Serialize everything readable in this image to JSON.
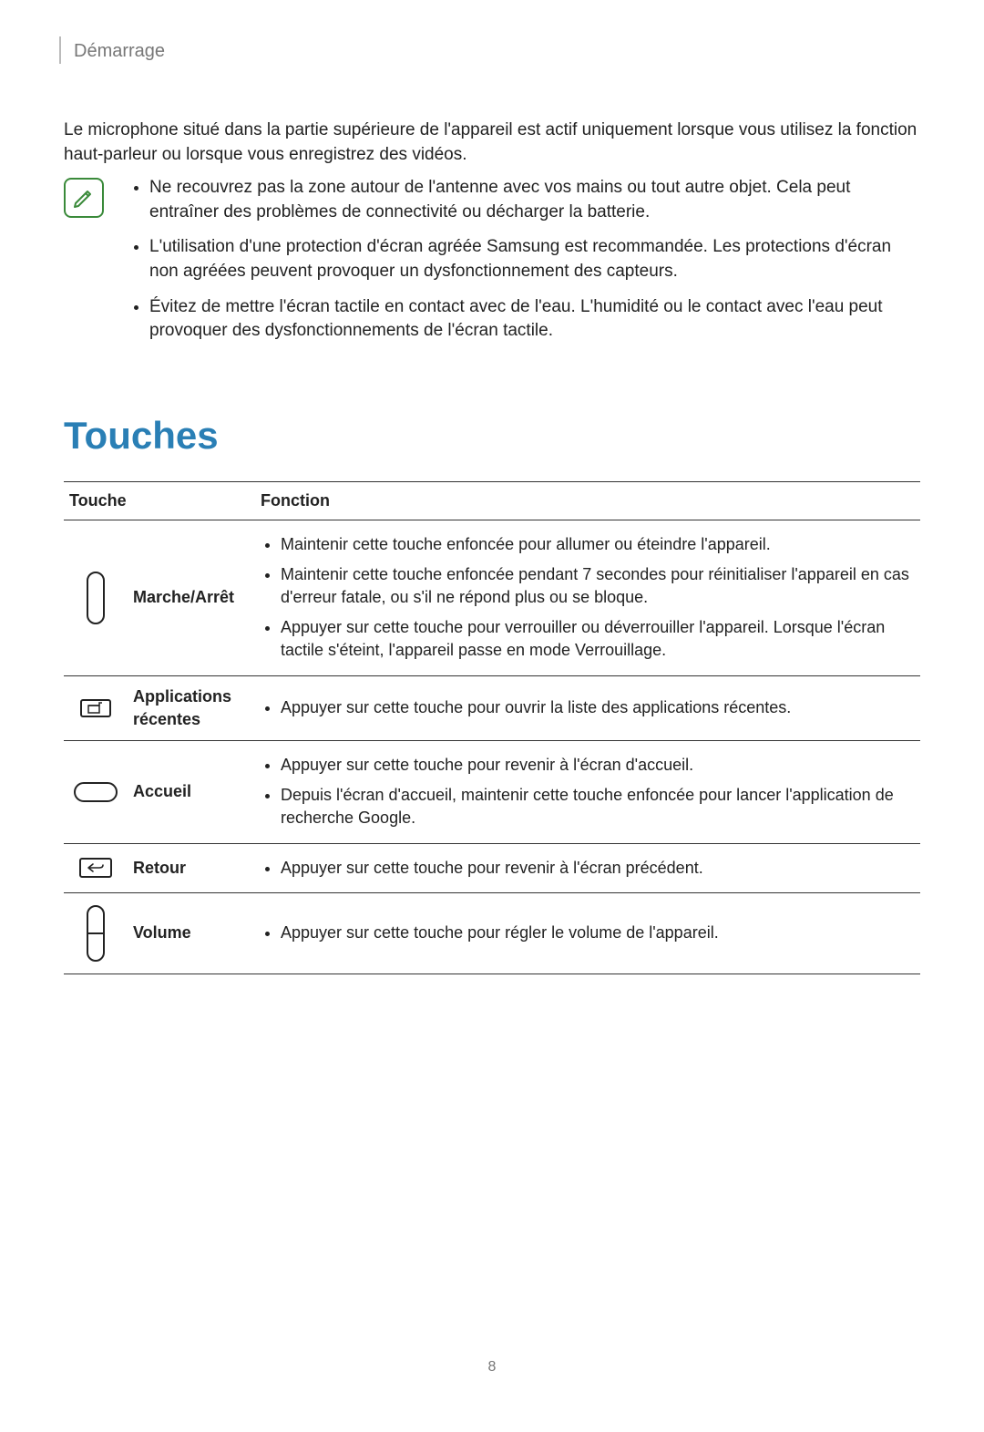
{
  "header": {
    "breadcrumb": "Démarrage"
  },
  "intro": "Le microphone situé dans la partie supérieure de l'appareil est actif uniquement lorsque vous utilisez la fonction haut-parleur ou lorsque vous enregistrez des vidéos.",
  "notes": [
    "Ne recouvrez pas la zone autour de l'antenne avec vos mains ou tout autre objet. Cela peut entraîner des problèmes de connectivité ou décharger la batterie.",
    "L'utilisation d'une protection d'écran agréée Samsung est recommandée. Les protections d'écran non agréées peuvent provoquer un dysfonctionnement des capteurs.",
    "Évitez de mettre l'écran tactile en contact avec de l'eau. L'humidité ou le contact avec l'eau peut provoquer des dysfonctionnements de l'écran tactile."
  ],
  "section_title": "Touches",
  "table": {
    "header": {
      "col1": "Touche",
      "col2": "Fonction"
    },
    "rows": [
      {
        "label": "Marche/Arrêt",
        "icon": "power-button-icon",
        "functions": [
          "Maintenir cette touche enfoncée pour allumer ou éteindre l'appareil.",
          "Maintenir cette touche enfoncée pendant 7 secondes pour réinitialiser l'appareil en cas d'erreur fatale, ou s'il ne répond plus ou se bloque.",
          "Appuyer sur cette touche pour verrouiller ou déverrouiller l'appareil. Lorsque l'écran tactile s'éteint, l'appareil passe en mode Verrouillage."
        ]
      },
      {
        "label": "Applications récentes",
        "icon": "recent-apps-icon",
        "functions": [
          "Appuyer sur cette touche pour ouvrir la liste des applications récentes."
        ]
      },
      {
        "label": "Accueil",
        "icon": "home-button-icon",
        "functions": [
          "Appuyer sur cette touche pour revenir à l'écran d'accueil.",
          "Depuis l'écran d'accueil, maintenir cette touche enfoncée pour lancer l'application de recherche Google."
        ]
      },
      {
        "label": "Retour",
        "icon": "back-button-icon",
        "functions": [
          "Appuyer sur cette touche pour revenir à l'écran précédent."
        ]
      },
      {
        "label": "Volume",
        "icon": "volume-button-icon",
        "functions": [
          "Appuyer sur cette touche pour régler le volume de l'appareil."
        ]
      }
    ]
  },
  "page_number": "8"
}
